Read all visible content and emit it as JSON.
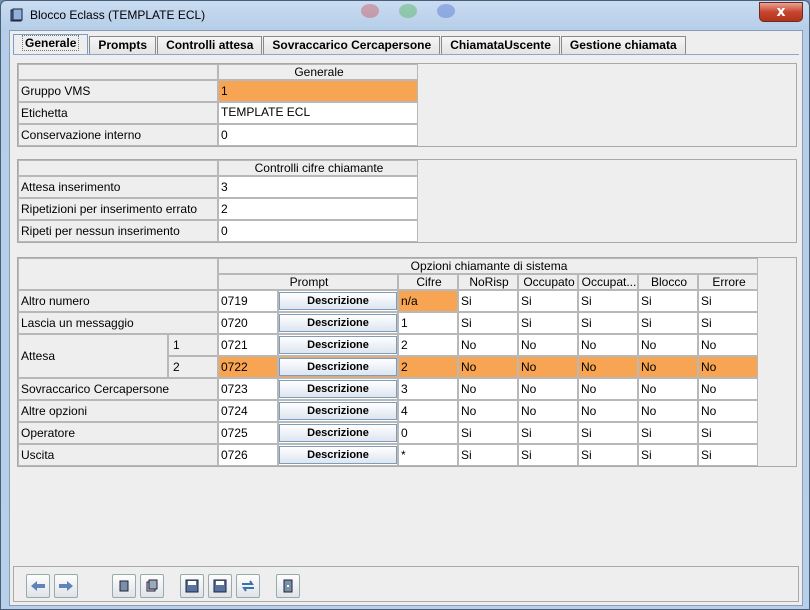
{
  "window": {
    "title": "Blocco Eclass (TEMPLATE ECL)",
    "close_label": "x"
  },
  "tabs": [
    "Generale",
    "Prompts",
    "Controlli attesa",
    "Sovraccarico Cercapersone",
    "ChiamataUscente",
    "Gestione chiamata"
  ],
  "generale": {
    "header": "Generale",
    "rows": [
      {
        "label": "Gruppo VMS",
        "value": "1"
      },
      {
        "label": "Etichetta",
        "value": "TEMPLATE ECL"
      },
      {
        "label": "Conservazione interno",
        "value": "0"
      }
    ]
  },
  "controlli": {
    "header": "Controlli cifre chiamante",
    "rows": [
      {
        "label": "Attesa inserimento",
        "value": "3"
      },
      {
        "label": "Ripetizioni per inserimento errato",
        "value": "2"
      },
      {
        "label": "Ripeti per nessun inserimento",
        "value": "0"
      }
    ]
  },
  "opzioni": {
    "header": "Opzioni chiamante di sistema",
    "columns": [
      "Prompt",
      "Cifre",
      "NoRisp",
      "Occupato",
      "Occupat...",
      "Blocco",
      "Errore"
    ],
    "button_label": "Descrizione",
    "attesa_label": "Attesa",
    "rows": [
      {
        "label": "Altro numero",
        "sub": "",
        "prompt": "0719",
        "cifre": "n/a",
        "norisp": "Si",
        "occupato": "Si",
        "occupat2": "Si",
        "blocco": "Si",
        "errore": "Si"
      },
      {
        "label": "Lascia un messaggio",
        "sub": "",
        "prompt": "0720",
        "cifre": "1",
        "norisp": "Si",
        "occupato": "Si",
        "occupat2": "Si",
        "blocco": "Si",
        "errore": "Si"
      },
      {
        "label": "",
        "sub": "1",
        "prompt": "0721",
        "cifre": "2",
        "norisp": "No",
        "occupato": "No",
        "occupat2": "No",
        "blocco": "No",
        "errore": "No"
      },
      {
        "label": "",
        "sub": "2",
        "prompt": "0722",
        "cifre": "2",
        "norisp": "No",
        "occupato": "No",
        "occupat2": "No",
        "blocco": "No",
        "errore": "No"
      },
      {
        "label": "Sovraccarico Cercapersone",
        "sub": "",
        "prompt": "0723",
        "cifre": "3",
        "norisp": "No",
        "occupato": "No",
        "occupat2": "No",
        "blocco": "No",
        "errore": "No"
      },
      {
        "label": "Altre opzioni",
        "sub": "",
        "prompt": "0724",
        "cifre": "4",
        "norisp": "No",
        "occupato": "No",
        "occupat2": "No",
        "blocco": "No",
        "errore": "No"
      },
      {
        "label": "Operatore",
        "sub": "",
        "prompt": "0725",
        "cifre": "0",
        "norisp": "Si",
        "occupato": "Si",
        "occupat2": "Si",
        "blocco": "Si",
        "errore": "Si"
      },
      {
        "label": "Uscita",
        "sub": "",
        "prompt": "0726",
        "cifre": "*",
        "norisp": "Si",
        "occupato": "Si",
        "occupat2": "Si",
        "blocco": "Si",
        "errore": "Si"
      }
    ]
  },
  "toolbar": {
    "buttons": [
      "back-arrow-icon",
      "forward-arrow-icon",
      "book-icon",
      "copy-icon",
      "save-icon",
      "save-as-icon",
      "refresh-icon",
      "exit-icon"
    ]
  },
  "colors": {
    "highlight": "#f7a552",
    "accent": "#7f9db9"
  }
}
